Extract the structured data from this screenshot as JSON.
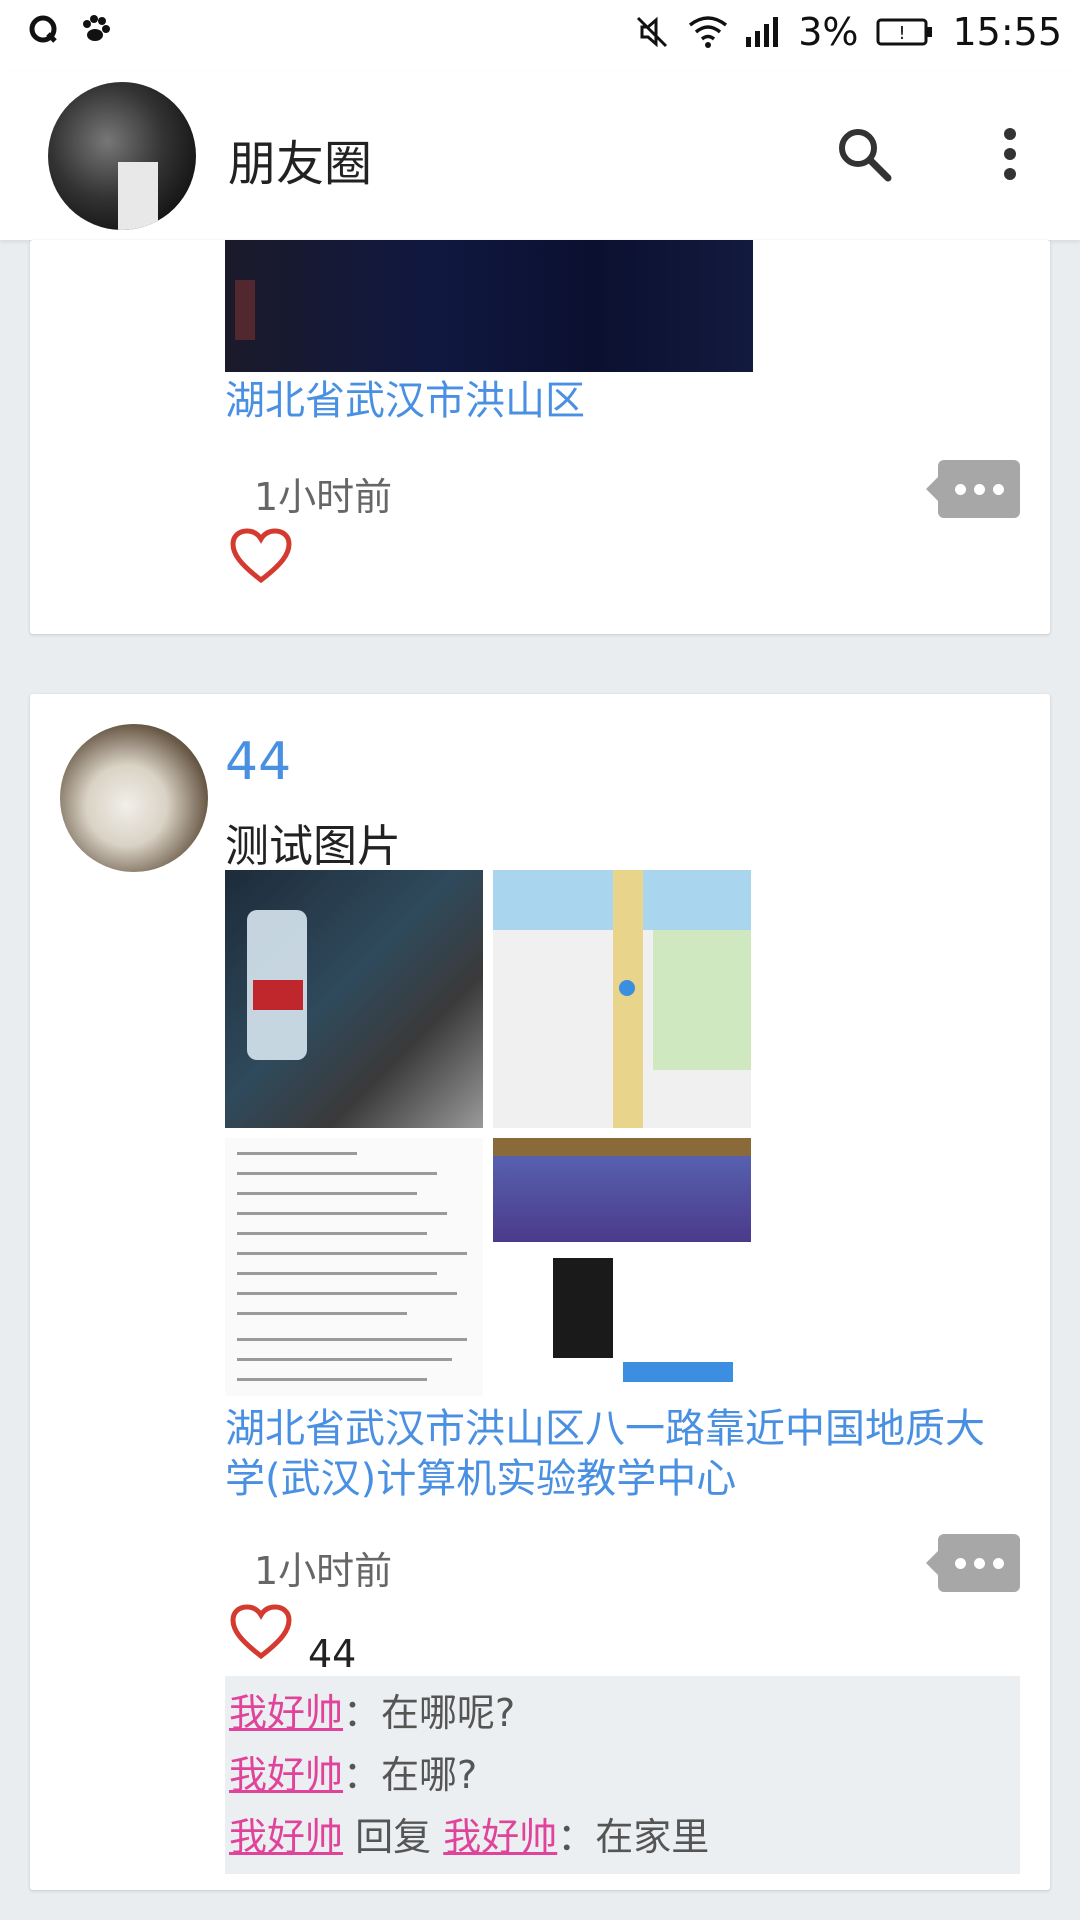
{
  "status_bar": {
    "battery": "3%",
    "time": "15:55"
  },
  "header": {
    "title": "朋友圈"
  },
  "feed": {
    "posts": [
      {
        "location": "湖北省武汉市洪山区",
        "time": "1小时前",
        "likes": ""
      },
      {
        "author": "44",
        "text": "测试图片",
        "location": "湖北省武汉市洪山区八一路靠近中国地质大学(武汉)计算机实验教学中心",
        "time": "1小时前",
        "likes": "44",
        "comments": [
          {
            "user": "我好帅",
            "separator": "：",
            "text": "在哪呢?"
          },
          {
            "user": "我好帅",
            "separator": "：",
            "text": "在哪?"
          },
          {
            "user": "我好帅",
            "reply_word": "回复",
            "reply_to": "我好帅",
            "separator": "：",
            "text": "在家里"
          }
        ]
      }
    ]
  },
  "colors": {
    "link": "#4a90e2",
    "comment_user": "#e0449a",
    "heart": "#d43a2f",
    "background": "#e9edf0"
  },
  "icons": [
    "qq-icon",
    "baidu-icon",
    "mute-icon",
    "wifi-icon",
    "signal-icon",
    "battery-icon",
    "search-icon",
    "more-vert-icon",
    "heart-icon",
    "comment-more-icon"
  ]
}
